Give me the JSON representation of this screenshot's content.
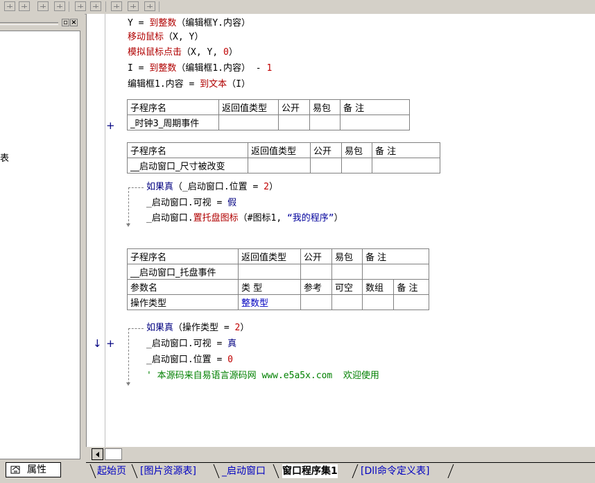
{
  "left_panel": {
    "fragment_text": "表",
    "property_tab_label": "属性"
  },
  "code_lines": [
    {
      "parts": [
        {
          "t": "Y = ",
          "c": "blk"
        },
        {
          "t": "到整数",
          "c": "fn"
        },
        {
          "t": "（编辑框Y.内容）",
          "c": "blk"
        }
      ]
    },
    {
      "parts": [
        {
          "t": "移动鼠标",
          "c": "fn"
        },
        {
          "t": "（X, Y）",
          "c": "blk"
        }
      ]
    },
    {
      "parts": [
        {
          "t": "模拟鼠标点击",
          "c": "fn"
        },
        {
          "t": "（X, Y, ",
          "c": "blk"
        },
        {
          "t": "0",
          "c": "num"
        },
        {
          "t": "）",
          "c": "blk"
        }
      ]
    },
    {
      "parts": [
        {
          "t": "I = ",
          "c": "blk"
        },
        {
          "t": "到整数",
          "c": "fn"
        },
        {
          "t": "（编辑框1.内容） - ",
          "c": "blk"
        },
        {
          "t": "1",
          "c": "num"
        }
      ]
    },
    {
      "parts": [
        {
          "t": "编辑框1.内容 = ",
          "c": "blk"
        },
        {
          "t": "到文本",
          "c": "fn"
        },
        {
          "t": "（I）",
          "c": "blk"
        }
      ]
    }
  ],
  "tables": {
    "t1": {
      "headers": [
        "子程序名",
        "返回值类型",
        "公开",
        "易包",
        "备 注"
      ],
      "row": [
        "_时钟3_周期事件",
        "",
        "",
        "",
        ""
      ]
    },
    "t2": {
      "headers": [
        "子程序名",
        "返回值类型",
        "公开",
        "易包",
        "备 注"
      ],
      "row": [
        "__启动窗口_尺寸被改变",
        "",
        "",
        "",
        ""
      ]
    },
    "t3": {
      "headers": [
        "子程序名",
        "返回值类型",
        "公开",
        "易包",
        "备 注"
      ],
      "row": [
        "__启动窗口_托盘事件",
        "",
        "",
        "",
        ""
      ],
      "param_headers": [
        "参数名",
        "类 型",
        "参考",
        "可空",
        "数组",
        "备 注"
      ],
      "param_row": [
        "操作类型",
        "整数型",
        "",
        "",
        "",
        ""
      ]
    }
  },
  "block2": [
    {
      "parts": [
        {
          "t": "如果真",
          "c": "kw"
        },
        {
          "t": "（_启动窗口.位置 = ",
          "c": "blk"
        },
        {
          "t": "2",
          "c": "num"
        },
        {
          "t": "）",
          "c": "blk"
        }
      ]
    },
    {
      "parts": [
        {
          "t": "_启动窗口.可视 = ",
          "c": "blk"
        },
        {
          "t": "假",
          "c": "kw"
        }
      ]
    },
    {
      "parts": [
        {
          "t": "_启动窗口.",
          "c": "blk"
        },
        {
          "t": "置托盘图标",
          "c": "fn"
        },
        {
          "t": "（#图标1, ",
          "c": "blk"
        },
        {
          "t": "“我的程序”",
          "c": "str"
        },
        {
          "t": "）",
          "c": "blk"
        }
      ]
    }
  ],
  "block3": [
    {
      "parts": [
        {
          "t": "如果真",
          "c": "kw"
        },
        {
          "t": "（操作类型 = ",
          "c": "blk"
        },
        {
          "t": "2",
          "c": "num"
        },
        {
          "t": "）",
          "c": "blk"
        }
      ]
    },
    {
      "parts": [
        {
          "t": "_启动窗口.可视 = ",
          "c": "blk"
        },
        {
          "t": "真",
          "c": "kw"
        }
      ]
    },
    {
      "parts": [
        {
          "t": "_启动窗口.位置 = ",
          "c": "blk"
        },
        {
          "t": "0",
          "c": "num"
        }
      ]
    },
    {
      "parts": [
        {
          "t": "' 本源码来自易语言源码网 www.e5a5x.com  欢迎使用",
          "c": "cm"
        }
      ]
    }
  ],
  "gutter": {
    "plus1": "+",
    "plus2": "+",
    "arrow": "↓"
  },
  "tabs": [
    {
      "label": "起始页",
      "active": false
    },
    {
      "label": "[图片资源表]",
      "active": false
    },
    {
      "label": "_启动窗口",
      "active": false
    },
    {
      "label": "窗口程序集1",
      "active": true
    },
    {
      "label": "[Dll命令定义表]",
      "active": false
    }
  ],
  "colors": {
    "keyword": "#000080",
    "function": "#b00000",
    "number": "#c00000",
    "string": "#00009c",
    "comment": "#008000",
    "link": "#0000c0"
  }
}
